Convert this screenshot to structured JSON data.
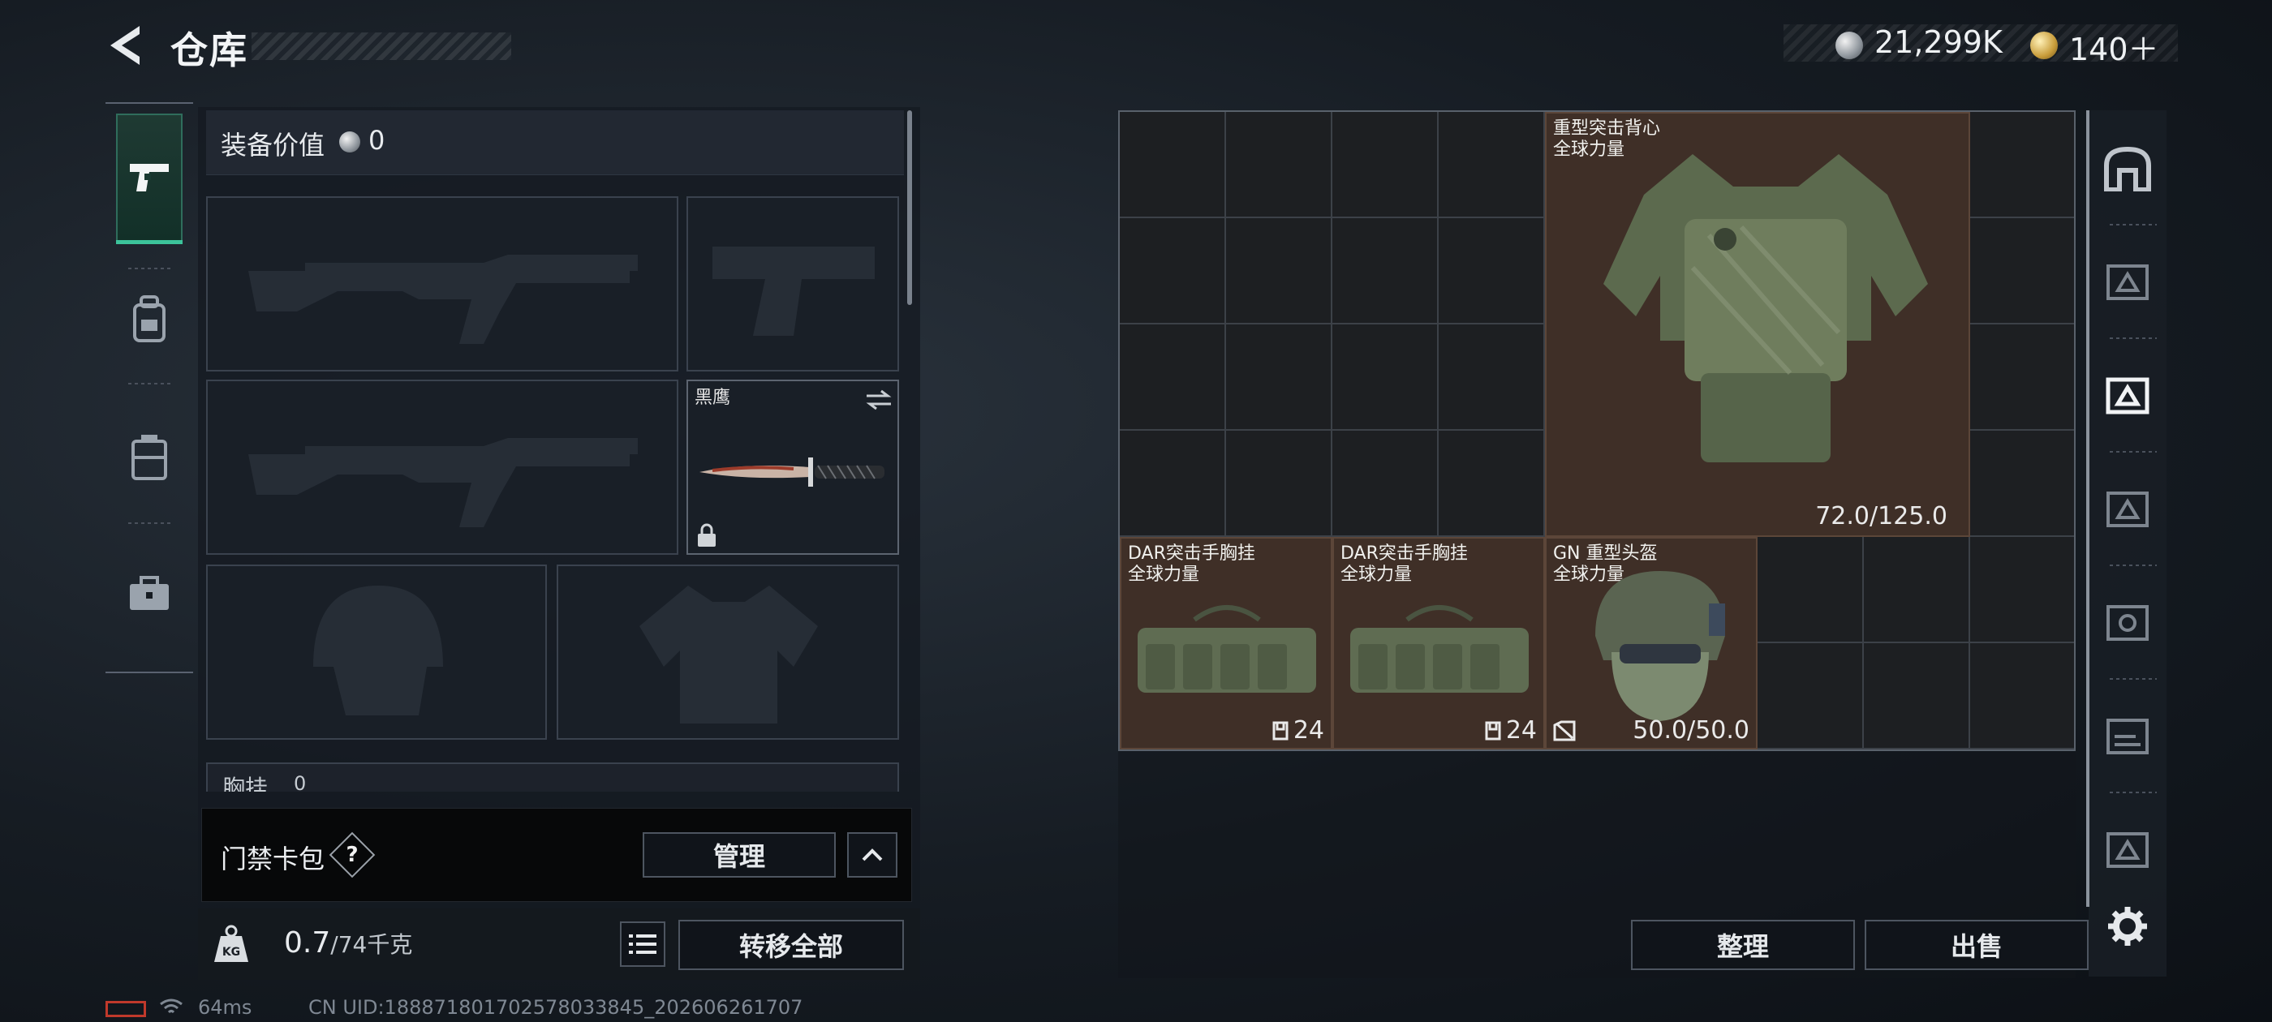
{
  "header": {
    "title": "仓库"
  },
  "currency": {
    "silver_amount": "21,299K",
    "gold_amount": "140＋"
  },
  "equipment": {
    "value_label": "装备价值",
    "value": "0",
    "melee_name": "黑鹰",
    "section_label_partial": "胸挂",
    "section_count_partial": "0"
  },
  "keycard": {
    "label": "门禁卡包",
    "help": "?",
    "manage_button": "管理"
  },
  "weight": {
    "current": "0.7",
    "max": "/74千克"
  },
  "actions": {
    "transfer_all": "转移全部",
    "organize": "整理",
    "sell": "出售"
  },
  "stash_items": [
    {
      "name": "重型突击背心",
      "sub": "全球力量",
      "durability": "72.0/125.0"
    },
    {
      "name": "DAR突击手胸挂",
      "sub": "全球力量",
      "capacity": "24"
    },
    {
      "name": "DAR突击手胸挂",
      "sub": "全球力量",
      "capacity": "24"
    },
    {
      "name": "GN 重型头盔",
      "sub": "全球力量",
      "durability": "50.0/50.0"
    }
  ],
  "status": {
    "ping": "64ms",
    "uid": "CN UID:18887180170257803384­5_202606261707"
  },
  "colors": {
    "accent": "#3cc39a",
    "item_bg": "#3f2f27"
  }
}
